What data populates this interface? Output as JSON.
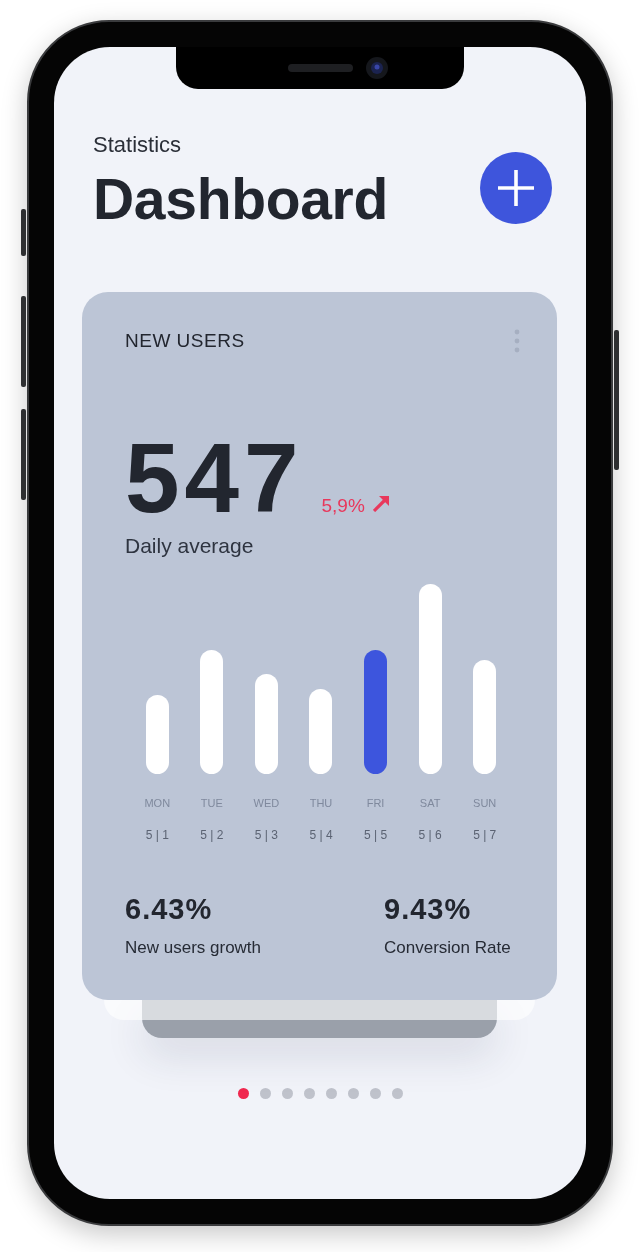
{
  "header": {
    "subtitle": "Statistics",
    "title": "Dashboard"
  },
  "card": {
    "title": "NEW USERS",
    "value": "547",
    "change": "5,9%",
    "value_label": "Daily average",
    "chart": {
      "days": [
        {
          "day": "MON",
          "date": "5 | 1",
          "selected": false
        },
        {
          "day": "TUE",
          "date": "5 | 2",
          "selected": false
        },
        {
          "day": "WED",
          "date": "5 | 3",
          "selected": false
        },
        {
          "day": "THU",
          "date": "5 | 4",
          "selected": false
        },
        {
          "day": "FRI",
          "date": "5 | 5",
          "selected": true
        },
        {
          "day": "SAT",
          "date": "5 | 6",
          "selected": false
        },
        {
          "day": "SUN",
          "date": "5 | 7",
          "selected": false
        }
      ]
    },
    "stats": [
      {
        "value": "6.43%",
        "label": "New users growth"
      },
      {
        "value": "9.43%",
        "label": "Conversion Rate"
      }
    ]
  },
  "pagination": [
    {
      "selected": true
    },
    {
      "selected": false
    },
    {
      "selected": false
    },
    {
      "selected": false
    },
    {
      "selected": false
    },
    {
      "selected": false
    },
    {
      "selected": false
    },
    {
      "selected": false
    }
  ]
}
